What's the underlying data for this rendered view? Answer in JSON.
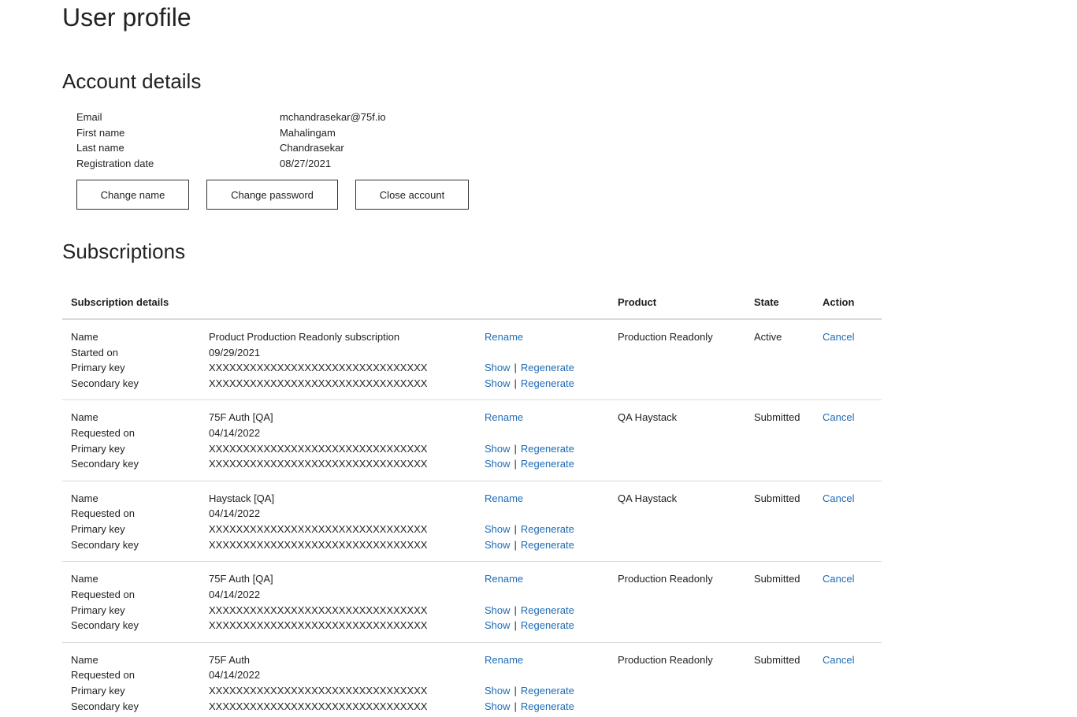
{
  "page_title": "User profile",
  "account": {
    "section_title": "Account details",
    "fields": [
      {
        "label": "Email",
        "value": "mchandrasekar@75f.io"
      },
      {
        "label": "First name",
        "value": "Mahalingam"
      },
      {
        "label": "Last name",
        "value": "Chandrasekar"
      },
      {
        "label": "Registration date",
        "value": "08/27/2021"
      }
    ],
    "buttons": {
      "change_name": "Change name",
      "change_password": "Change password",
      "close_account": "Close account"
    }
  },
  "subscriptions": {
    "section_title": "Subscriptions",
    "headers": {
      "details": "Subscription details",
      "product": "Product",
      "state": "State",
      "action": "Action"
    },
    "labels": {
      "name": "Name",
      "primary_key": "Primary key",
      "secondary_key": "Secondary key",
      "rename": "Rename",
      "show": "Show",
      "separator": "|",
      "regenerate": "Regenerate",
      "cancel": "Cancel"
    },
    "rows": [
      {
        "name": "Product Production Readonly subscription",
        "date_label": "Started on",
        "date": "09/29/2021",
        "primary_key": "XXXXXXXXXXXXXXXXXXXXXXXXXXXXXXXX",
        "secondary_key": "XXXXXXXXXXXXXXXXXXXXXXXXXXXXXXXX",
        "product": "Production Readonly",
        "state": "Active"
      },
      {
        "name": "75F Auth [QA]",
        "date_label": "Requested on",
        "date": "04/14/2022",
        "primary_key": "XXXXXXXXXXXXXXXXXXXXXXXXXXXXXXXX",
        "secondary_key": "XXXXXXXXXXXXXXXXXXXXXXXXXXXXXXXX",
        "product": "QA Haystack",
        "state": "Submitted"
      },
      {
        "name": "Haystack [QA]",
        "date_label": "Requested on",
        "date": "04/14/2022",
        "primary_key": "XXXXXXXXXXXXXXXXXXXXXXXXXXXXXXXX",
        "secondary_key": "XXXXXXXXXXXXXXXXXXXXXXXXXXXXXXXX",
        "product": "QA Haystack",
        "state": "Submitted"
      },
      {
        "name": "75F Auth [QA]",
        "date_label": "Requested on",
        "date": "04/14/2022",
        "primary_key": "XXXXXXXXXXXXXXXXXXXXXXXXXXXXXXXX",
        "secondary_key": "XXXXXXXXXXXXXXXXXXXXXXXXXXXXXXXX",
        "product": "Production Readonly",
        "state": "Submitted"
      },
      {
        "name": "75F Auth",
        "date_label": "Requested on",
        "date": "04/14/2022",
        "primary_key": "XXXXXXXXXXXXXXXXXXXXXXXXXXXXXXXX",
        "secondary_key": "XXXXXXXXXXXXXXXXXXXXXXXXXXXXXXXX",
        "product": "Production Readonly",
        "state": "Submitted"
      }
    ]
  },
  "colors": {
    "link": "#1f6cb5",
    "divider": "#d9d9d9",
    "text": "#1f1f1f"
  }
}
